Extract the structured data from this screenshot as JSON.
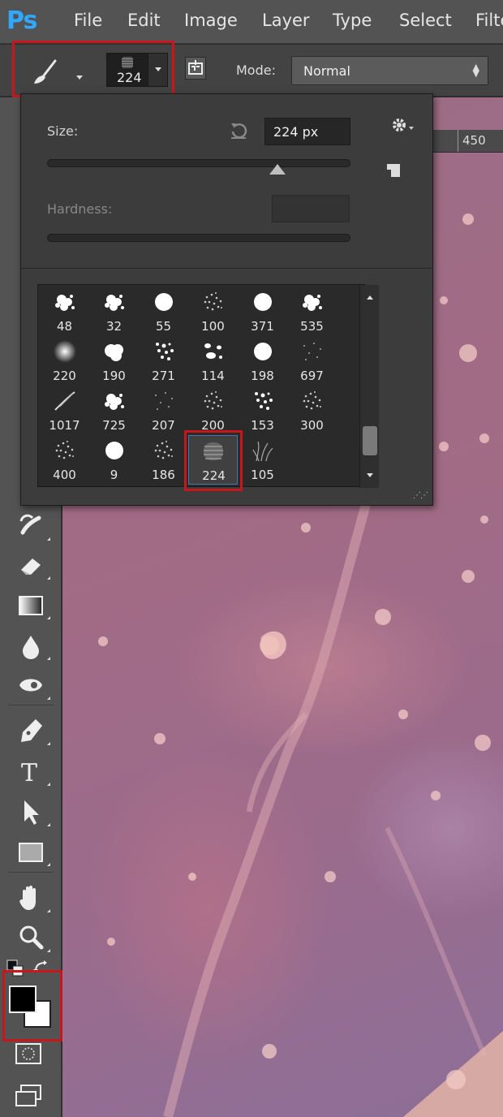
{
  "app": {
    "logo": "Ps"
  },
  "menu": [
    "File",
    "Edit",
    "Image",
    "Layer",
    "Type",
    "Select",
    "Filte"
  ],
  "options_bar": {
    "brush_size": "224",
    "mode_label": "Mode:",
    "mode_value": "Normal"
  },
  "ruler": {
    "tick": "450"
  },
  "brush_panel": {
    "size_label": "Size:",
    "size_value": "224 px",
    "size_slider_fraction": 0.76,
    "hardness_label": "Hardness:",
    "presets": [
      {
        "size": "48",
        "shape": "splatter"
      },
      {
        "size": "32",
        "shape": "splatter"
      },
      {
        "size": "55",
        "shape": "hard-round"
      },
      {
        "size": "100",
        "shape": "speckle"
      },
      {
        "size": "371",
        "shape": "hard-round"
      },
      {
        "size": "535",
        "shape": "splatter"
      },
      {
        "size": "220",
        "shape": "soft-round"
      },
      {
        "size": "190",
        "shape": "cloud"
      },
      {
        "size": "271",
        "shape": "dots"
      },
      {
        "size": "114",
        "shape": "dabs"
      },
      {
        "size": "198",
        "shape": "hard-round"
      },
      {
        "size": "697",
        "shape": "sparse"
      },
      {
        "size": "1017",
        "shape": "stroke"
      },
      {
        "size": "725",
        "shape": "splatter"
      },
      {
        "size": "207",
        "shape": "sparse"
      },
      {
        "size": "200",
        "shape": "speckle"
      },
      {
        "size": "153",
        "shape": "dots"
      },
      {
        "size": "300",
        "shape": "speckle"
      },
      {
        "size": "400",
        "shape": "speckle"
      },
      {
        "size": "9",
        "shape": "hard-round"
      },
      {
        "size": "186",
        "shape": "speckle"
      },
      {
        "size": "224",
        "shape": "texture",
        "selected": true
      },
      {
        "size": "105",
        "shape": "grass"
      }
    ]
  },
  "colors": {
    "foreground": "#000000",
    "background": "#ffffff",
    "highlight": "#c8161d",
    "selection_border": "#4a74a6"
  },
  "tools": [
    "history-brush-icon",
    "eraser-icon",
    "gradient-icon",
    "blur-icon",
    "dodge-icon",
    "pen-icon",
    "type-icon",
    "path-selection-icon",
    "rectangle-icon",
    "hand-icon",
    "zoom-icon",
    "default-colors-icon",
    "swap-colors-icon",
    "quick-mask-icon",
    "screen-mode-icon"
  ]
}
